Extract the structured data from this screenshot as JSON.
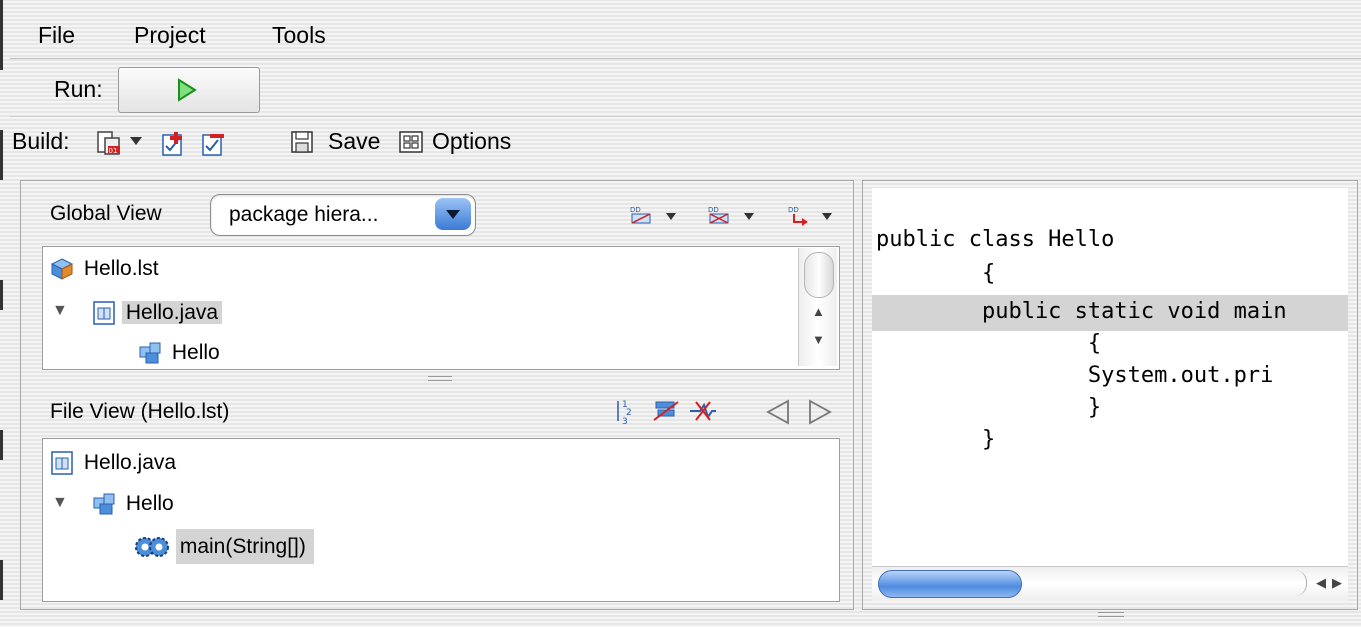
{
  "menu": {
    "items": [
      "File",
      "Project",
      "Tools"
    ]
  },
  "run": {
    "label": "Run:"
  },
  "build": {
    "label": "Build:",
    "save_label": "Save",
    "options_label": "Options"
  },
  "global_view": {
    "label": "Global View",
    "scope_selected": "package hiera...",
    "items": [
      {
        "label": "Hello.lst",
        "icon": "library-cube-icon"
      },
      {
        "label": "Hello.java",
        "icon": "java-file-icon",
        "expanded": true,
        "selected": true
      },
      {
        "label": "Hello",
        "icon": "class-icon"
      }
    ]
  },
  "file_view": {
    "label": "File View (Hello.lst)",
    "items": [
      {
        "label": "Hello.java",
        "icon": "java-file-icon"
      },
      {
        "label": "Hello",
        "icon": "class-icon",
        "expanded": true
      },
      {
        "label": "main(String[])",
        "icon": "method-gear-icon",
        "selected": true
      }
    ]
  },
  "editor": {
    "lines": [
      "public class Hello",
      "        {",
      "        public static void main",
      "                {",
      "                System.out.pri",
      "                }",
      "        }"
    ],
    "current_line_index": 2
  },
  "colors": {
    "selection": "#d4d4d4",
    "accent_blue": "#3a7ad6",
    "run_green": "#2db82d",
    "icon_red": "#d42020"
  }
}
